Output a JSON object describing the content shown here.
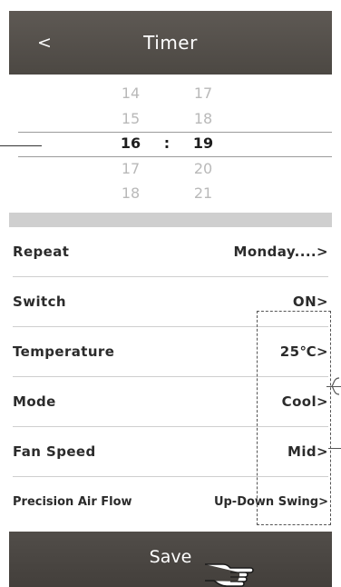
{
  "header": {
    "back_label": "<",
    "title": "Timer"
  },
  "picker": {
    "rows": [
      {
        "hour": "14",
        "minute": "17"
      },
      {
        "hour": "15",
        "minute": "18"
      },
      {
        "hour": "16",
        "minute": "19"
      },
      {
        "hour": "17",
        "minute": "20"
      },
      {
        "hour": "18",
        "minute": "21"
      }
    ],
    "separator": ":"
  },
  "settings": [
    {
      "label": "Repeat",
      "value": "Monday....>"
    },
    {
      "label": "Switch",
      "value": "ON>"
    },
    {
      "label": "Temperature",
      "value": "25℃>"
    },
    {
      "label": "Mode",
      "value": "Cool>"
    },
    {
      "label": "Fan Speed",
      "value": "Mid>"
    },
    {
      "label": "Precision Air Flow",
      "value": "Up-Down Swing>"
    }
  ],
  "footer": {
    "save_label": "Save"
  },
  "colors": {
    "header_bg": "#57524d",
    "save_bg": "#4a4642",
    "separator_band": "#cfcfcf",
    "selected_text": "#1e1e1e",
    "unselected_text": "#b9b9b9"
  }
}
